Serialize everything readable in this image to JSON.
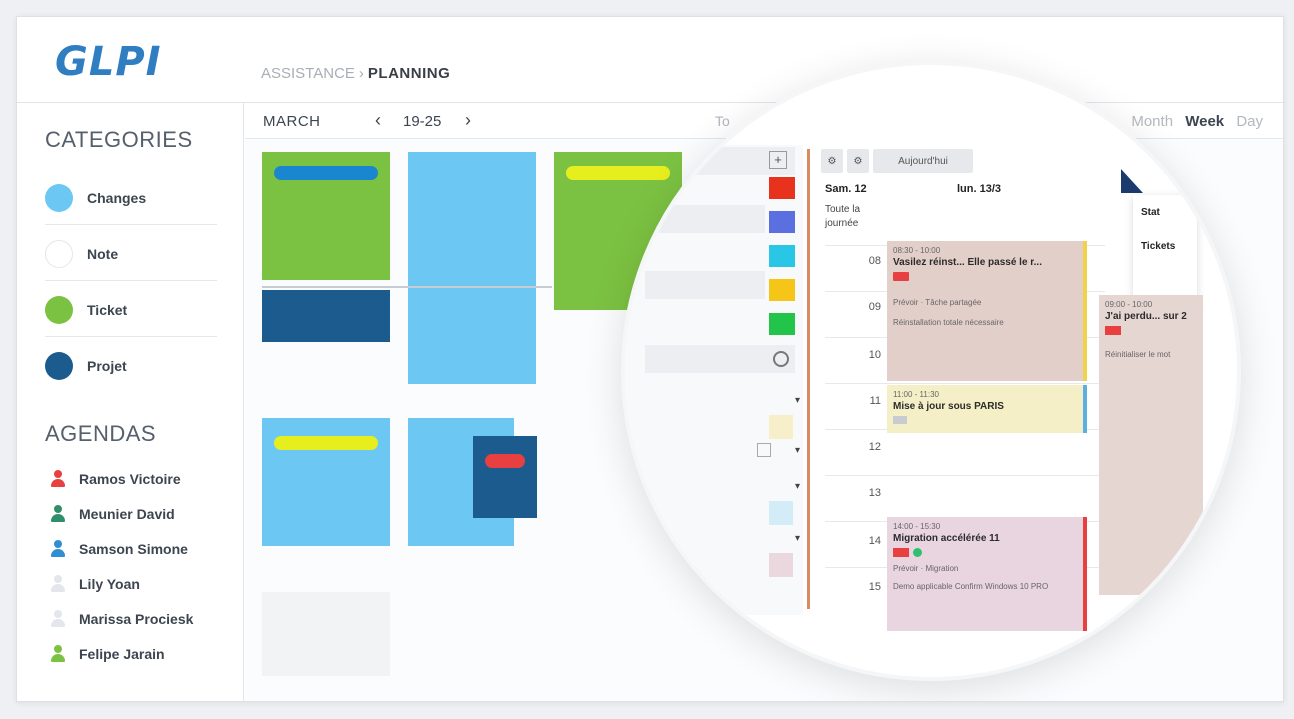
{
  "header": {
    "logo": "GLPI",
    "breadcrumb": {
      "crumb1": "ASSISTANCE",
      "separator": "›",
      "crumb2": "PLANNING"
    }
  },
  "sidebar": {
    "categories_heading": "CATEGORIES",
    "categories": [
      {
        "label": "Changes",
        "color": "#6cc8f2"
      },
      {
        "label": "Note",
        "color": "#ffffff"
      },
      {
        "label": "Ticket",
        "color": "#7cc242"
      },
      {
        "label": "Projet",
        "color": "#1b5b8e"
      }
    ],
    "agendas_heading": "AGENDAS",
    "agendas": [
      {
        "label": "Ramos Victoire",
        "color": "#e84040"
      },
      {
        "label": "Meunier David",
        "color": "#2f8f6a"
      },
      {
        "label": "Samson Simone",
        "color": "#2f8fd0"
      },
      {
        "label": "Lily Yoan",
        "color": "#e8eaed"
      },
      {
        "label": "Marissa Prociesk",
        "color": "#e8eaed"
      },
      {
        "label": "Felipe Jarain",
        "color": "#7cc242"
      }
    ]
  },
  "toolbar": {
    "month": "MARCH",
    "prev": "‹",
    "week_range": "19-25",
    "next": "›",
    "today_fragment": "To",
    "views": {
      "month": "Month",
      "week": "Week",
      "day": "Day"
    }
  },
  "colors": {
    "ticket": "#7cc242",
    "change": "#6cc8f2",
    "project": "#1b5b8e",
    "yellow": "#e6ee1e",
    "blue_pill": "#1a86cf",
    "red": "#e84040"
  },
  "lens": {
    "header_buttons": [
      "⚙",
      "⚙",
      "Aujourd'hui"
    ],
    "day_sat": "Sam. 12",
    "day_mon": "lun. 13/3",
    "allday": [
      "Toute la",
      "journée"
    ],
    "hours": [
      "08",
      "09",
      "10",
      "11",
      "12",
      "13",
      "14",
      "15"
    ],
    "popup_items": [
      "Stat",
      "Tickets"
    ],
    "events": [
      {
        "time": "08:30 - 10:00",
        "title": "Vasilez réinst... Elle passé le r...",
        "meta": "Prévoir · Tâche partagée",
        "note": "Réinstallation totale nécessaire"
      },
      {
        "time": "11:00 - 11:30",
        "title": "Mise à jour sous PARIS",
        "meta": ""
      },
      {
        "time": "14:00 - 15:30",
        "title": "Migration accélérée 11",
        "meta": "Prévoir · Migration",
        "note": "Demo applicable Confirm Windows 10 PRO"
      },
      {
        "time": "09:00 - 10:00",
        "title": "J'ai perdu... sur 2",
        "meta": "",
        "note": "Réinitialiser le mot"
      }
    ]
  }
}
